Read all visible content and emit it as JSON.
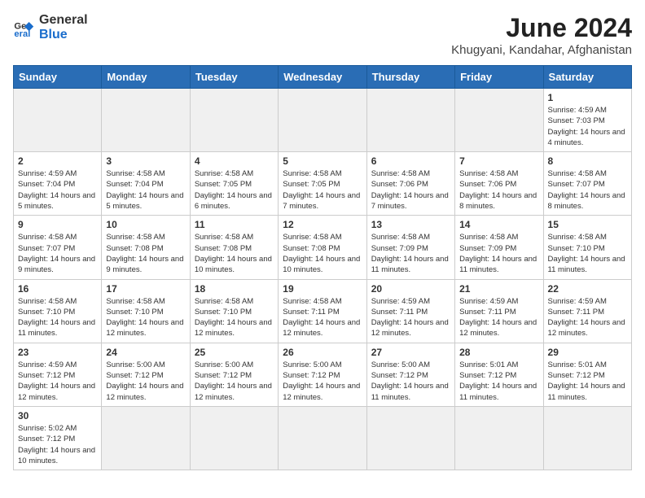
{
  "header": {
    "logo_general": "General",
    "logo_blue": "Blue",
    "month_title": "June 2024",
    "location": "Khugyani, Kandahar, Afghanistan"
  },
  "days_of_week": [
    "Sunday",
    "Monday",
    "Tuesday",
    "Wednesday",
    "Thursday",
    "Friday",
    "Saturday"
  ],
  "weeks": [
    [
      {
        "day": "",
        "empty": true
      },
      {
        "day": "",
        "empty": true
      },
      {
        "day": "",
        "empty": true
      },
      {
        "day": "",
        "empty": true
      },
      {
        "day": "",
        "empty": true
      },
      {
        "day": "",
        "empty": true
      },
      {
        "day": "1",
        "sunrise": "4:59 AM",
        "sunset": "7:03 PM",
        "daylight": "14 hours and 4 minutes."
      }
    ],
    [
      {
        "day": "2",
        "sunrise": "4:59 AM",
        "sunset": "7:04 PM",
        "daylight": "14 hours and 5 minutes."
      },
      {
        "day": "3",
        "sunrise": "4:58 AM",
        "sunset": "7:04 PM",
        "daylight": "14 hours and 5 minutes."
      },
      {
        "day": "4",
        "sunrise": "4:58 AM",
        "sunset": "7:05 PM",
        "daylight": "14 hours and 6 minutes."
      },
      {
        "day": "5",
        "sunrise": "4:58 AM",
        "sunset": "7:05 PM",
        "daylight": "14 hours and 7 minutes."
      },
      {
        "day": "6",
        "sunrise": "4:58 AM",
        "sunset": "7:06 PM",
        "daylight": "14 hours and 7 minutes."
      },
      {
        "day": "7",
        "sunrise": "4:58 AM",
        "sunset": "7:06 PM",
        "daylight": "14 hours and 8 minutes."
      },
      {
        "day": "8",
        "sunrise": "4:58 AM",
        "sunset": "7:07 PM",
        "daylight": "14 hours and 8 minutes."
      }
    ],
    [
      {
        "day": "9",
        "sunrise": "4:58 AM",
        "sunset": "7:07 PM",
        "daylight": "14 hours and 9 minutes."
      },
      {
        "day": "10",
        "sunrise": "4:58 AM",
        "sunset": "7:08 PM",
        "daylight": "14 hours and 9 minutes."
      },
      {
        "day": "11",
        "sunrise": "4:58 AM",
        "sunset": "7:08 PM",
        "daylight": "14 hours and 10 minutes."
      },
      {
        "day": "12",
        "sunrise": "4:58 AM",
        "sunset": "7:08 PM",
        "daylight": "14 hours and 10 minutes."
      },
      {
        "day": "13",
        "sunrise": "4:58 AM",
        "sunset": "7:09 PM",
        "daylight": "14 hours and 11 minutes."
      },
      {
        "day": "14",
        "sunrise": "4:58 AM",
        "sunset": "7:09 PM",
        "daylight": "14 hours and 11 minutes."
      },
      {
        "day": "15",
        "sunrise": "4:58 AM",
        "sunset": "7:10 PM",
        "daylight": "14 hours and 11 minutes."
      }
    ],
    [
      {
        "day": "16",
        "sunrise": "4:58 AM",
        "sunset": "7:10 PM",
        "daylight": "14 hours and 11 minutes."
      },
      {
        "day": "17",
        "sunrise": "4:58 AM",
        "sunset": "7:10 PM",
        "daylight": "14 hours and 12 minutes."
      },
      {
        "day": "18",
        "sunrise": "4:58 AM",
        "sunset": "7:10 PM",
        "daylight": "14 hours and 12 minutes."
      },
      {
        "day": "19",
        "sunrise": "4:58 AM",
        "sunset": "7:11 PM",
        "daylight": "14 hours and 12 minutes."
      },
      {
        "day": "20",
        "sunrise": "4:59 AM",
        "sunset": "7:11 PM",
        "daylight": "14 hours and 12 minutes."
      },
      {
        "day": "21",
        "sunrise": "4:59 AM",
        "sunset": "7:11 PM",
        "daylight": "14 hours and 12 minutes."
      },
      {
        "day": "22",
        "sunrise": "4:59 AM",
        "sunset": "7:11 PM",
        "daylight": "14 hours and 12 minutes."
      }
    ],
    [
      {
        "day": "23",
        "sunrise": "4:59 AM",
        "sunset": "7:12 PM",
        "daylight": "14 hours and 12 minutes."
      },
      {
        "day": "24",
        "sunrise": "5:00 AM",
        "sunset": "7:12 PM",
        "daylight": "14 hours and 12 minutes."
      },
      {
        "day": "25",
        "sunrise": "5:00 AM",
        "sunset": "7:12 PM",
        "daylight": "14 hours and 12 minutes."
      },
      {
        "day": "26",
        "sunrise": "5:00 AM",
        "sunset": "7:12 PM",
        "daylight": "14 hours and 12 minutes."
      },
      {
        "day": "27",
        "sunrise": "5:00 AM",
        "sunset": "7:12 PM",
        "daylight": "14 hours and 11 minutes."
      },
      {
        "day": "28",
        "sunrise": "5:01 AM",
        "sunset": "7:12 PM",
        "daylight": "14 hours and 11 minutes."
      },
      {
        "day": "29",
        "sunrise": "5:01 AM",
        "sunset": "7:12 PM",
        "daylight": "14 hours and 11 minutes."
      }
    ],
    [
      {
        "day": "30",
        "sunrise": "5:02 AM",
        "sunset": "7:12 PM",
        "daylight": "14 hours and 10 minutes."
      },
      {
        "day": "",
        "empty": true
      },
      {
        "day": "",
        "empty": true
      },
      {
        "day": "",
        "empty": true
      },
      {
        "day": "",
        "empty": true
      },
      {
        "day": "",
        "empty": true
      },
      {
        "day": "",
        "empty": true
      }
    ]
  ]
}
